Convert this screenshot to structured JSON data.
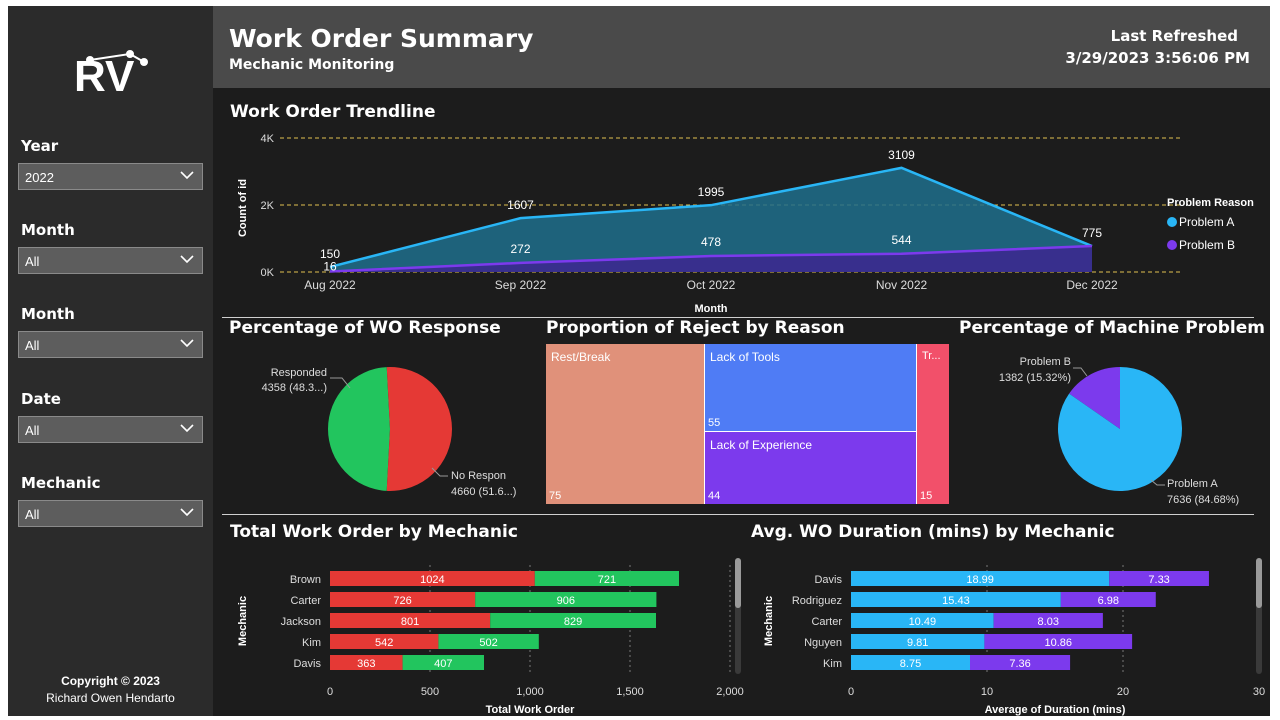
{
  "brand": {
    "logo_text": "RV"
  },
  "header": {
    "title": "Work Order Summary",
    "subtitle": "Mechanic Monitoring",
    "refresh_label": "Last Refreshed",
    "refresh_value": "3/29/2023 3:56:06 PM"
  },
  "filters": [
    {
      "label": "Year",
      "value": "2022"
    },
    {
      "label": "Month",
      "value": "All"
    },
    {
      "label": "Month",
      "value": "All"
    },
    {
      "label": "Date",
      "value": "All"
    },
    {
      "label": "Mechanic",
      "value": "All"
    }
  ],
  "copyright": {
    "line1": "Copyright © 2023",
    "line2": "Richard Owen Hendarto"
  },
  "colors": {
    "problem_a": "#29b6f6",
    "problem_b": "#7c3aed",
    "red": "#e53935",
    "green": "#22c55e",
    "salmon": "#e0917a",
    "blue": "#4f7cf5",
    "violet": "#7c3aed",
    "pink": "#f2506a",
    "bg": "#1c1c1c"
  },
  "sections": {
    "trend": "Work Order Trendline",
    "wo_response": "Percentage of WO Response",
    "reject": "Proportion of Reject by Reason",
    "machine": "Percentage of Machine Problem",
    "total_wo": "Total Work Order by Mechanic",
    "avg_dur": "Avg. WO Duration (mins) by Mechanic"
  },
  "chart_data": [
    {
      "type": "area",
      "title": "Work Order Trendline",
      "xlabel": "Month",
      "ylabel": "Count of id",
      "categories": [
        "Aug 2022",
        "Sep 2022",
        "Oct 2022",
        "Nov 2022",
        "Dec 2022"
      ],
      "y_ticks": [
        "0K",
        "2K",
        "4K"
      ],
      "ylim": [
        0,
        4000
      ],
      "legend_title": "Problem Reason",
      "legend_position": "right",
      "series": [
        {
          "name": "Problem A",
          "values": [
            150,
            1607,
            1995,
            3109,
            775
          ]
        },
        {
          "name": "Problem B",
          "values": [
            16,
            272,
            478,
            544,
            775
          ]
        }
      ],
      "labels_a": [
        "150",
        "1607",
        "1995",
        "3109",
        "775"
      ],
      "labels_b": [
        "16",
        "272",
        "478",
        "544"
      ]
    },
    {
      "type": "pie",
      "title": "Percentage of WO Response",
      "slices": [
        {
          "name": "Responded",
          "value": 4358,
          "label": "Responded",
          "sub": "4358 (48.3...)"
        },
        {
          "name": "No Respon",
          "value": 4660,
          "label": "No Respon",
          "sub": "4660 (51.6...)"
        }
      ]
    },
    {
      "type": "treemap",
      "title": "Proportion of Reject by Reason",
      "items": [
        {
          "name": "Rest/Break",
          "value": "75"
        },
        {
          "name": "Lack of Tools",
          "value": "55"
        },
        {
          "name": "Lack of Experience",
          "value": "44"
        },
        {
          "name": "Tr...",
          "value": "15"
        }
      ]
    },
    {
      "type": "pie",
      "title": "Percentage of Machine Problem",
      "slices": [
        {
          "name": "Problem A",
          "value": 7636,
          "label": "Problem A",
          "sub": "7636 (84.68%)"
        },
        {
          "name": "Problem B",
          "value": 1382,
          "label": "Problem B",
          "sub": "1382 (15.32%)"
        }
      ]
    },
    {
      "type": "bar",
      "title": "Total Work Order by Mechanic",
      "xlabel": "Total Work Order",
      "ylabel": "Mechanic",
      "categories": [
        "Brown",
        "Carter",
        "Jackson",
        "Kim",
        "Davis"
      ],
      "xlim": [
        0,
        2000
      ],
      "x_ticks": [
        "0",
        "500",
        "1,000",
        "1,500",
        "2,000"
      ],
      "series": [
        {
          "values": [
            1024,
            726,
            801,
            542,
            363
          ]
        },
        {
          "values": [
            721,
            906,
            829,
            502,
            407
          ]
        }
      ]
    },
    {
      "type": "bar",
      "title": "Avg. WO Duration (mins) by Mechanic",
      "xlabel": "Average of Duration (mins)",
      "ylabel": "Mechanic",
      "categories": [
        "Davis",
        "Rodriguez",
        "Carter",
        "Nguyen",
        "Kim"
      ],
      "xlim": [
        0,
        30
      ],
      "x_ticks": [
        "0",
        "10",
        "20",
        "30"
      ],
      "series": [
        {
          "values": [
            18.99,
            15.43,
            10.49,
            9.81,
            8.75
          ]
        },
        {
          "values": [
            7.33,
            6.98,
            8.03,
            10.86,
            7.36
          ]
        }
      ]
    }
  ]
}
